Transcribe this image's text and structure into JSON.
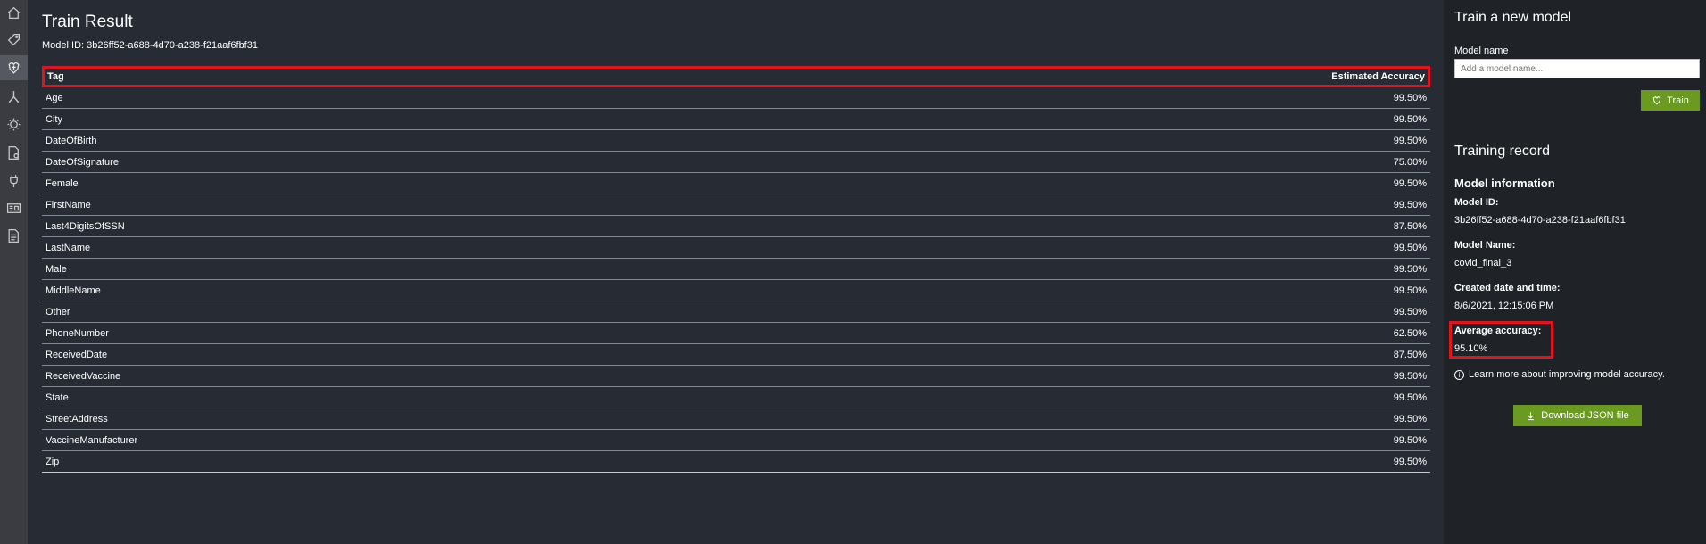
{
  "nav": {
    "items": [
      {
        "icon": "home-icon"
      },
      {
        "icon": "tag-icon"
      },
      {
        "icon": "train-model-icon"
      },
      {
        "icon": "merge-icon"
      },
      {
        "icon": "lightbulb-icon"
      },
      {
        "icon": "document-settings-icon"
      },
      {
        "icon": "connector-icon"
      },
      {
        "icon": "id-card-icon"
      },
      {
        "icon": "document-list-icon"
      }
    ],
    "active_index": 2
  },
  "main": {
    "title": "Train Result",
    "model_id": "Model ID: 3b26ff52-a688-4d70-a238-f21aaf6fbf31",
    "table": {
      "headers": [
        "Tag",
        "Estimated Accuracy"
      ],
      "rows": [
        [
          "Age",
          "99.50%"
        ],
        [
          "City",
          "99.50%"
        ],
        [
          "DateOfBirth",
          "99.50%"
        ],
        [
          "DateOfSignature",
          "75.00%"
        ],
        [
          "Female",
          "99.50%"
        ],
        [
          "FirstName",
          "99.50%"
        ],
        [
          "Last4DigitsOfSSN",
          "87.50%"
        ],
        [
          "LastName",
          "99.50%"
        ],
        [
          "Male",
          "99.50%"
        ],
        [
          "MiddleName",
          "99.50%"
        ],
        [
          "Other",
          "99.50%"
        ],
        [
          "PhoneNumber",
          "62.50%"
        ],
        [
          "ReceivedDate",
          "87.50%"
        ],
        [
          "ReceivedVaccine",
          "99.50%"
        ],
        [
          "State",
          "99.50%"
        ],
        [
          "StreetAddress",
          "99.50%"
        ],
        [
          "VaccineManufacturer",
          "99.50%"
        ],
        [
          "Zip",
          "99.50%"
        ]
      ]
    }
  },
  "side": {
    "train_title": "Train a new model",
    "model_name_label": "Model name",
    "model_name_value": "",
    "model_name_placeholder": "Add a model name...",
    "train_button": "Train",
    "record_title": "Training record",
    "info_title": "Model information",
    "model_id_label": "Model ID:",
    "model_id_value": "3b26ff52-a688-4d70-a238-f21aaf6fbf31",
    "model_name_info_label": "Model Name:",
    "model_name_info_value": "covid_final_3",
    "created_label": "Created date and time:",
    "created_value": "8/6/2021, 12:15:06 PM",
    "avg_label": "Average accuracy:",
    "avg_value": "95.10%",
    "learn_more": "Learn more about improving model accuracy.",
    "download_button": "Download JSON file"
  },
  "colors": {
    "background": "#272b33",
    "nav": "#3a3c42",
    "side_panel": "#1f2227",
    "accent_green": "#6a9a1f",
    "highlight_red": "#e3131e"
  }
}
